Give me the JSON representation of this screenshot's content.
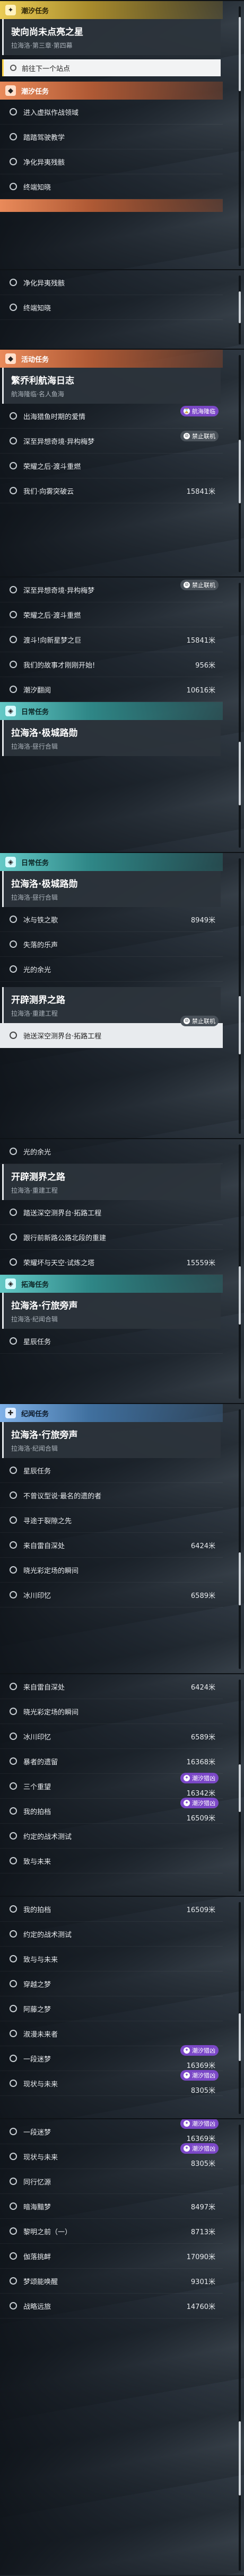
{
  "tags": {
    "limited": "限时任务",
    "no_link": "禁止联机",
    "cosmic": "潮汐猎凶"
  },
  "main_task": {
    "header": "潮汐任务",
    "title": "驶向尚未点亮之星",
    "subtitle": "拉海洛·第三章·第四幕",
    "current": "前往下一个站点"
  },
  "side_section": {
    "header": "潮汐任务",
    "items": [
      "进入虚拟作战领域",
      "踏踏驾驶教学",
      "净化异夷残骸",
      "终端知晓"
    ]
  },
  "s2_items": [
    "净化异夷残骸",
    "终端知晓"
  ],
  "event": {
    "header": "活动任务",
    "title": "繁乔利航海日志",
    "subtitle": "航海隆临·名人鱼海",
    "items": [
      {
        "label": "出海猎鱼时期的爱情",
        "dist": "航海隆临"
      },
      {
        "label": "深至异想奇境·异构梅梦",
        "dist": ""
      },
      {
        "label": "荣耀之后·渡斗重燃",
        "dist": ""
      },
      {
        "label": "我们·向雾突破云",
        "dist": "15841米"
      }
    ]
  },
  "s3_items": [
    {
      "label": "深至异想奇境·异构梅梦",
      "dist": ""
    },
    {
      "label": "荣耀之后·渡斗重燃",
      "dist": ""
    },
    {
      "label": "渡斗!向新星梦之巨",
      "dist": "15841米"
    },
    {
      "label": "我们的故事才刚刚开始!",
      "dist": "956米"
    },
    {
      "label": "潮汐翻阅",
      "dist": "10616米"
    }
  ],
  "s3_sub": {
    "header": "日常任务",
    "title": "拉海洛·极城路勋",
    "subtitle": "拉海洛·昼行合辑"
  },
  "s4": {
    "header": "日常任务",
    "title": "拉海洛·极城路勋",
    "subtitle": "拉海洛·昼行合辑",
    "items": [
      {
        "label": "冰与铁之歌",
        "dist": "8949米"
      },
      {
        "label": "失落的乐声",
        "dist": ""
      },
      {
        "label": "光的余光",
        "dist": ""
      }
    ],
    "card2": {
      "title": "开辟测界之路",
      "subtitle": "拉海洛·重建工程"
    },
    "item2": "驰送深空测界台·拓路工程"
  },
  "s5": {
    "first": "光的余光",
    "card": {
      "title": "开辟测界之路",
      "subtitle": "拉海洛·重建工程"
    },
    "items": [
      {
        "label": "踏送深空测界台·拓路工程",
        "dist": ""
      },
      {
        "label": "跟行前新路公路北段的重建",
        "dist": ""
      },
      {
        "label": "荣耀坏与天空·试炼之塔",
        "dist": "15559米"
      }
    ],
    "hdr2": "拓海任务",
    "card2": {
      "title": "拉海洛·行旅旁声",
      "subtitle": "拉海洛·纪闻合辑"
    },
    "item2": "星辰任务"
  },
  "s6": {
    "header": "纪闻任务",
    "title": "拉海洛·行旅旁声",
    "subtitle": "拉海洛·纪闻合辑",
    "items": [
      {
        "label": "星辰任务",
        "dist": ""
      },
      {
        "label": "不曾议型说·最名的遗的者",
        "dist": ""
      },
      {
        "label": "寻途于裂隙之先",
        "dist": ""
      },
      {
        "label": "来自雷自深处",
        "dist": "6424米"
      },
      {
        "label": "晓光彩定场的瞬间",
        "dist": ""
      },
      {
        "label": "冰川印忆",
        "dist": "6589米"
      }
    ]
  },
  "s7_items": [
    {
      "label": "来自雷自深处",
      "dist": "6424米"
    },
    {
      "label": "晓光彩定场的瞬间",
      "dist": ""
    },
    {
      "label": "冰川印忆",
      "dist": "6589米"
    },
    {
      "label": "暴者的遗留",
      "dist": "16368米"
    },
    {
      "label": "三个重望",
      "dist": "16342米"
    },
    {
      "label": "我的拍档",
      "dist": "16509米"
    },
    {
      "label": "约定的战术测试",
      "dist": ""
    },
    {
      "label": "致与未来",
      "dist": ""
    }
  ],
  "s8_items": [
    {
      "label": "我的拍档",
      "dist": "16509米"
    },
    {
      "label": "约定的战术测试",
      "dist": ""
    },
    {
      "label": "致与与未来",
      "dist": ""
    },
    {
      "label": "穿越之梦",
      "dist": ""
    },
    {
      "label": "阿藤之梦",
      "dist": ""
    },
    {
      "label": "淑漫未来者",
      "dist": ""
    },
    {
      "label": "一段迷梦",
      "dist": "16369米"
    },
    {
      "label": "现状与未来",
      "dist": "8305米"
    }
  ],
  "s9_items": [
    {
      "label": "一段迷梦",
      "dist": "16369米"
    },
    {
      "label": "现状与未来",
      "dist": "8305米"
    },
    {
      "label": "同行忆源",
      "dist": ""
    },
    {
      "label": "暗海黯梦",
      "dist": "8497米"
    },
    {
      "label": "黎明之前（一）",
      "dist": "8713米"
    },
    {
      "label": "伽落挑衅",
      "dist": "17090米"
    },
    {
      "label": "梦颂能唤醒",
      "dist": "9301米"
    },
    {
      "label": "战略远旅",
      "dist": "14760米"
    }
  ]
}
